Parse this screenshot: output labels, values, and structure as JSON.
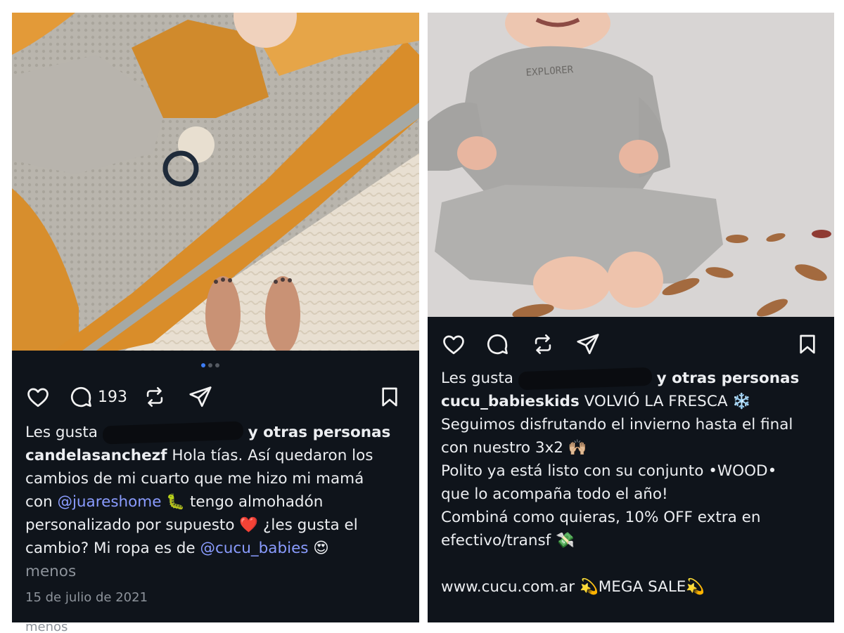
{
  "left_post": {
    "carousel": {
      "count": 3,
      "active": 1
    },
    "comment_count": "193",
    "likes_prefix": "Les gusta",
    "likes_suffix": "y otras personas",
    "username": "candelasanchezf",
    "caption_1": "Hola tías. Así quedaron los",
    "caption_2": "cambios de mi cuarto que me hizo mi mamá",
    "caption_3a": "con",
    "mention_1": "@juareshome",
    "emoji_1": "🐛",
    "caption_3b": "tengo almohadón",
    "caption_4a": "personalizado por supuesto",
    "emoji_2": "❤️",
    "caption_4b": "¿les gusta el",
    "caption_5a": "cambio? Mi ropa es de",
    "mention_2": "@cucu_babies",
    "emoji_3": "😍",
    "less": "menos",
    "date": "15 de julio de 2021",
    "cut_off_text": "menos"
  },
  "right_post": {
    "likes_prefix": "Les gusta",
    "likes_suffix": "y otras personas",
    "username": "cucu_babieskids",
    "caption_1": "VOLVIÓ LA FRESCA",
    "emoji_1": "❄️",
    "caption_2": "Seguimos disfrutando el invierno hasta el final",
    "caption_3": "con nuestro 3x2",
    "emoji_2": "🙌🏼",
    "caption_4": "Polito ya está listo con su conjunto •WOOD•",
    "caption_5": "que lo acompaña todo el año!",
    "caption_6": "Combiná como quieras, 10% OFF extra en",
    "caption_7": "efectivo/transf",
    "emoji_3": "💸",
    "caption_8a": "www.cucu.com.ar",
    "emoji_4": "💫",
    "caption_8b": "MEGA SALE",
    "emoji_5": "💫",
    "sweatshirt_print": "EXPLORER"
  },
  "colors": {
    "background": "#0f141b",
    "text": "#eceef1",
    "mention": "#8a9cff",
    "muted": "#8d939b",
    "carousel_active": "#3d7df6"
  },
  "icons": [
    "heart-icon",
    "comment-icon",
    "repost-icon",
    "share-icon",
    "bookmark-icon"
  ]
}
